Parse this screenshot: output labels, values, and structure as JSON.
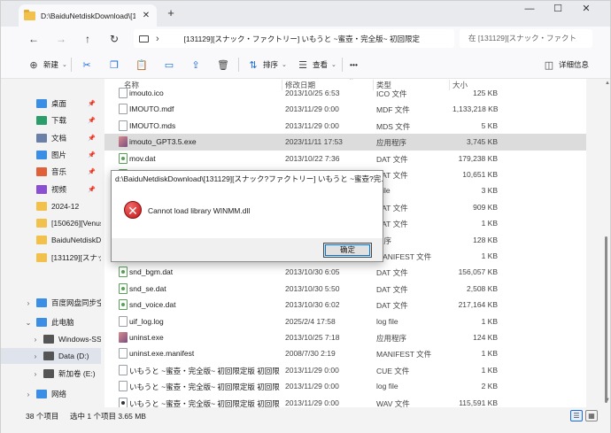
{
  "tab": {
    "title": "D:\\BaiduNetdiskDownload\\[13",
    "close": "✕",
    "add": "+"
  },
  "window_controls": {
    "minimize": "—",
    "maximize": "☐",
    "close": "✕"
  },
  "nav": {
    "back": "←",
    "forward": "→",
    "up": "↑",
    "refresh": "↻",
    "chevron": "›",
    "ellipsis": "…"
  },
  "address": "[131129][スナック・ファクトリー] いもうと ~蜜壺・完全版~ 初回限定",
  "search_placeholder": "在 [131129][スナック・ファクト",
  "toolbar": {
    "new_label": "新建",
    "sort_label": "排序",
    "view_label": "查看",
    "more_label": "•••",
    "details_label": "详细信息"
  },
  "icons": {
    "new": "⊕",
    "cut": "✂",
    "copy": "❐",
    "paste": "📋",
    "rename": "▭",
    "share": "⇪",
    "delete": "🗑",
    "sort": "⇅",
    "view": "☰",
    "details": "◫",
    "dropdown": "⌄"
  },
  "sidebar": {
    "items": [
      {
        "label": "桌面",
        "color": "#3a8ee6",
        "pinned": true
      },
      {
        "label": "下载",
        "color": "#2a9d6a",
        "pinned": true
      },
      {
        "label": "文档",
        "color": "#6b7fa8",
        "pinned": true
      },
      {
        "label": "图片",
        "color": "#3a8ee6",
        "pinned": true
      },
      {
        "label": "音乐",
        "color": "#e0603a",
        "pinned": true
      },
      {
        "label": "视频",
        "color": "#8a4fd3",
        "pinned": true
      },
      {
        "label": "2024-12",
        "color": "#f2c14b",
        "pinned": false
      },
      {
        "label": "[150626][Venus",
        "color": "#f2c14b",
        "pinned": false
      },
      {
        "label": "BaiduNetdiskD",
        "color": "#f2c14b",
        "pinned": false
      },
      {
        "label": "[131129][スナッ",
        "color": "#f2c14b",
        "pinned": false
      }
    ],
    "tree": [
      {
        "label": "百度网盘同步空",
        "color": "#3a8ee6",
        "expander": "›",
        "indent": 0
      },
      {
        "label": "此电脑",
        "color": "#3a8ee6",
        "expander": "⌄",
        "indent": 0
      },
      {
        "label": "Windows-SSD",
        "color": "#555555",
        "expander": "›",
        "indent": 1
      },
      {
        "label": "Data (D:)",
        "color": "#555555",
        "expander": "›",
        "indent": 1,
        "selected": true
      },
      {
        "label": "新加卷 (E:)",
        "color": "#555555",
        "expander": "›",
        "indent": 1
      },
      {
        "label": "网络",
        "color": "#3a8ee6",
        "expander": "›",
        "indent": 0
      }
    ]
  },
  "columns": {
    "name": "名称",
    "date": "修改日期",
    "type": "类型",
    "size": "大小",
    "sort_arrow": "^"
  },
  "files": [
    {
      "name": "imouto.ico",
      "date": "2013/10/25 6:53",
      "type": "ICO 文件",
      "size": "125 KB",
      "icon": "file"
    },
    {
      "name": "IMOUTO.mdf",
      "date": "2013/11/29 0:00",
      "type": "MDF 文件",
      "size": "1,133,218 KB",
      "icon": "file"
    },
    {
      "name": "IMOUTO.mds",
      "date": "2013/11/29 0:00",
      "type": "MDS 文件",
      "size": "5 KB",
      "icon": "file"
    },
    {
      "name": "imouto_GPT3.5.exe",
      "date": "2023/11/11 17:53",
      "type": "应用程序",
      "size": "3,745 KB",
      "icon": "exe",
      "selected": true
    },
    {
      "name": "mov.dat",
      "date": "2013/10/22 7:36",
      "type": "DAT 文件",
      "size": "179,238 KB",
      "icon": "dat"
    },
    {
      "name": "",
      "date": "",
      "type": "DAT 文件",
      "size": "10,651 KB",
      "icon": "dat"
    },
    {
      "name": "",
      "date": "",
      "type": "t file",
      "size": "3 KB",
      "icon": "file"
    },
    {
      "name": "",
      "date": "",
      "type": "DAT 文件",
      "size": "909 KB",
      "icon": "dat"
    },
    {
      "name": "",
      "date": "",
      "type": "DAT 文件",
      "size": "1 KB",
      "icon": "dat"
    },
    {
      "name": "",
      "date": "",
      "type": "程序",
      "size": "128 KB",
      "icon": "exe"
    },
    {
      "name": "",
      "date": "",
      "type": "MANIFEST 文件",
      "size": "1 KB",
      "icon": "file"
    },
    {
      "name": "snd_bgm.dat",
      "date": "2013/10/30 6:05",
      "type": "DAT 文件",
      "size": "156,057 KB",
      "icon": "dat"
    },
    {
      "name": "snd_se.dat",
      "date": "2013/10/30 5:50",
      "type": "DAT 文件",
      "size": "2,508 KB",
      "icon": "dat"
    },
    {
      "name": "snd_voice.dat",
      "date": "2013/10/30 6:02",
      "type": "DAT 文件",
      "size": "217,164 KB",
      "icon": "dat"
    },
    {
      "name": "uif_log.log",
      "date": "2025/2/4 17:58",
      "type": "log file",
      "size": "1 KB",
      "icon": "file"
    },
    {
      "name": "uninst.exe",
      "date": "2013/10/25 7:18",
      "type": "应用程序",
      "size": "124 KB",
      "icon": "exe"
    },
    {
      "name": "uninst.exe.manifest",
      "date": "2008/7/30 2:19",
      "type": "MANIFEST 文件",
      "size": "1 KB",
      "icon": "file"
    },
    {
      "name": "いもうと ~蜜壺・完全版~ 初回限定版 初回限...",
      "date": "2013/11/29 0:00",
      "type": "CUE 文件",
      "size": "1 KB",
      "icon": "file"
    },
    {
      "name": "いもうと ~蜜壺・完全版~ 初回限定版 初回限...",
      "date": "2013/11/29 0:00",
      "type": "log file",
      "size": "2 KB",
      "icon": "file"
    },
    {
      "name": "いもうと ~蜜壺・完全版~ 初回限定版 初回限...",
      "date": "2013/11/29 0:00",
      "type": "WAV 文件",
      "size": "115,591 KB",
      "icon": "wav"
    }
  ],
  "status": {
    "count": "38 个项目",
    "selection": "选中 1 个项目  3.65 MB",
    "list_view": "☰",
    "tile_view": "▦"
  },
  "scroll": {
    "up": "▲",
    "down": "▼"
  },
  "dialog": {
    "title": "d:\\BaiduNetdiskDownload\\[131129][スナック?ファクトリー] いもうと ~蜜壺?完...",
    "icon": "✕",
    "message": "Cannot load library WINMM.dll",
    "ok_label": "确定"
  }
}
